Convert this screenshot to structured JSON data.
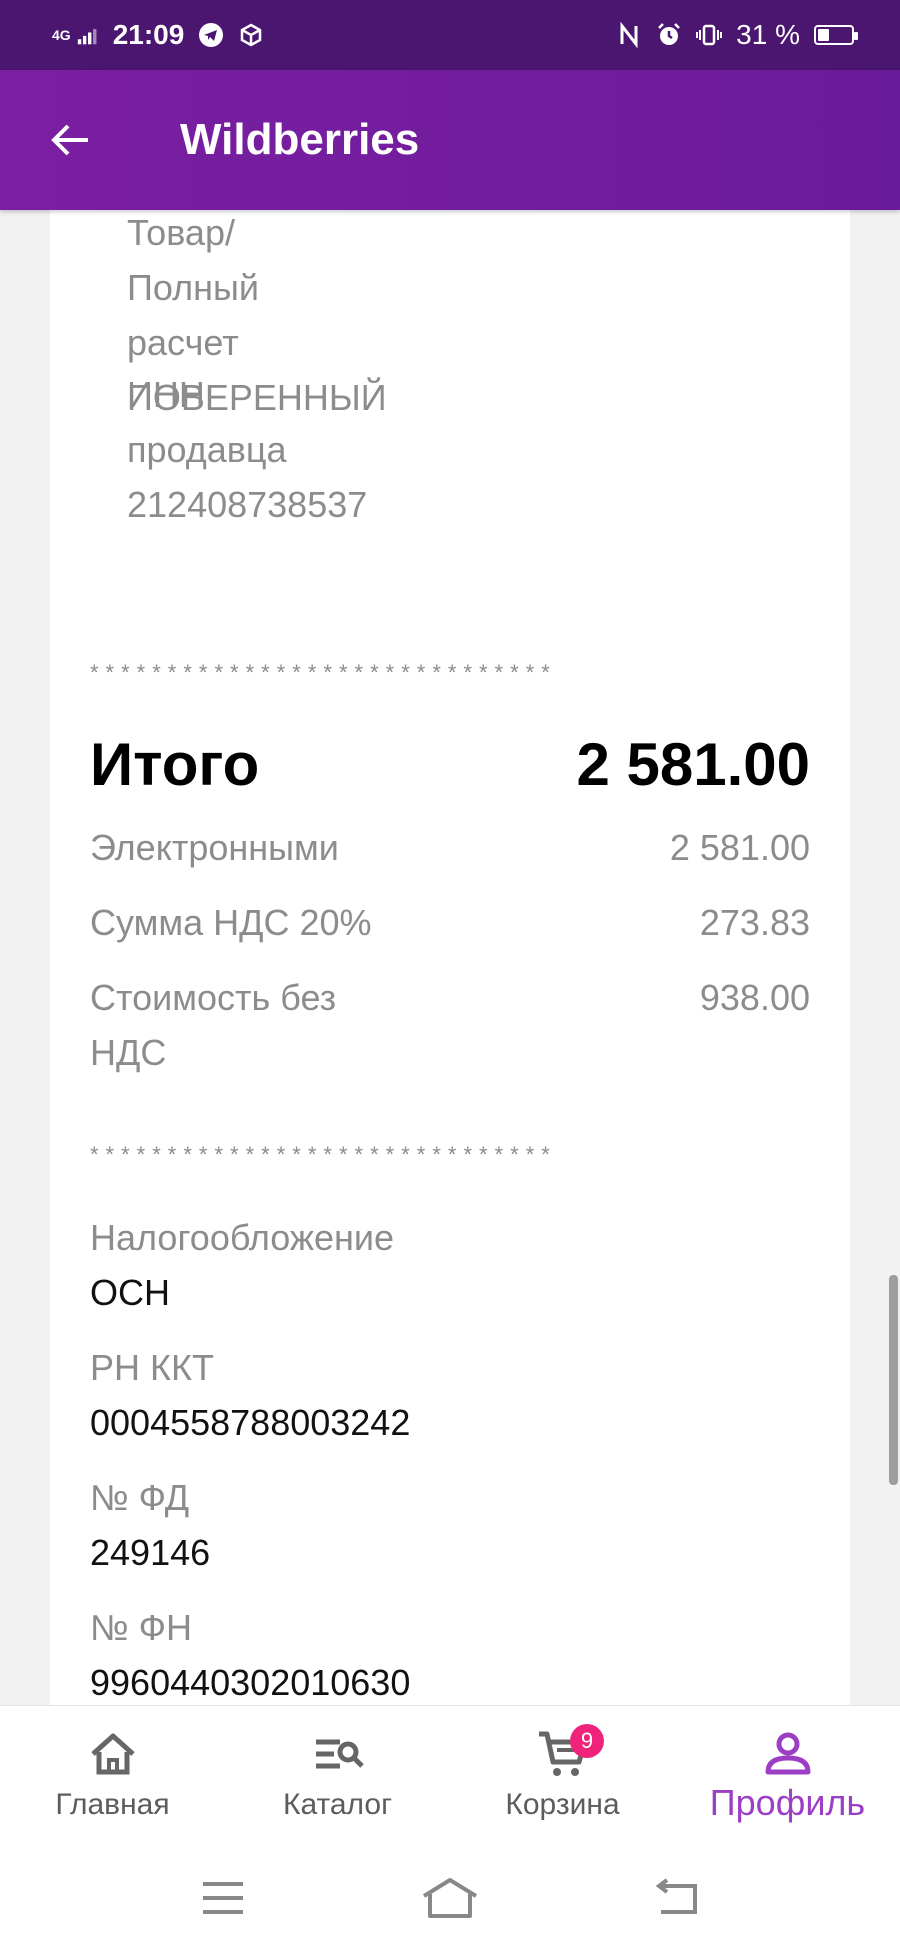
{
  "status_bar": {
    "network": "4G",
    "time": "21:09",
    "battery": "31 %",
    "battery_level": 0.31
  },
  "app_bar": {
    "title": "Wildberries"
  },
  "receipt": {
    "item_lines": [
      "Товар/",
      "Полный",
      "расчет",
      "ПОВЕРЕННЫЙ"
    ],
    "inn_lines": [
      "ИНН",
      "продавца",
      "212408738537"
    ],
    "separator": "******************************",
    "total_label": "Итого",
    "total_value": "2 581.00",
    "rows": [
      {
        "label": "Электронными",
        "value": "2 581.00"
      },
      {
        "label": "Сумма НДС 20%",
        "value": "273.83"
      },
      {
        "label": "Стоимость без НДС",
        "value": "938.00"
      }
    ],
    "details": [
      {
        "label": "Налогообложение",
        "value": "ОСН"
      },
      {
        "label": "РН ККТ",
        "value": "0004558788003242"
      },
      {
        "label": "№ ФД",
        "value": "249146"
      },
      {
        "label": "№ ФН",
        "value": "9960440302010630"
      }
    ]
  },
  "bottom_nav": {
    "items": [
      {
        "label": "Главная",
        "icon": "home-icon"
      },
      {
        "label": "Каталог",
        "icon": "catalog-search-icon"
      },
      {
        "label": "Корзина",
        "icon": "cart-icon",
        "badge": "9"
      },
      {
        "label": "Профиль",
        "icon": "profile-icon",
        "active": true
      }
    ]
  },
  "colors": {
    "app_bar": "#6a1b9a",
    "status_bar": "#4a1670",
    "active_nav": "#9c3fc5",
    "badge": "#f0237a"
  }
}
